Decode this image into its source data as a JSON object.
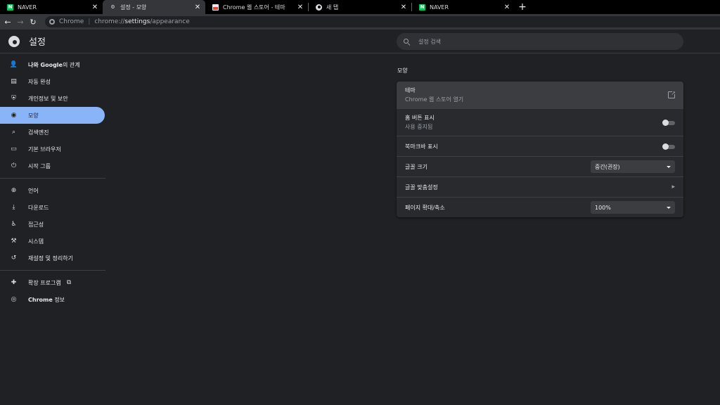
{
  "tabs": [
    {
      "title": "NAVER",
      "favicon": "naver-icon",
      "close": "✕"
    },
    {
      "title": "설정 - 모양",
      "favicon": "gear-icon",
      "close": "✕"
    },
    {
      "title": "Chrome 웹 스토어 - 테마",
      "favicon": "web-store-icon",
      "close": "✕"
    },
    {
      "title": "새 탭",
      "favicon": "chrome-icon",
      "close": "✕"
    },
    {
      "title": "NAVER",
      "favicon": "naver-icon",
      "close": "✕"
    }
  ],
  "new_tab_label": "+",
  "toolbar": {
    "back": "←",
    "forward": "→",
    "reload": "↻",
    "site_label": "Chrome",
    "url_prefix": "chrome://",
    "url_bold": "settings",
    "url_suffix": "/appearance"
  },
  "header": {
    "title": "설정",
    "search_placeholder": "설정 검색"
  },
  "sidebar": {
    "items": [
      {
        "label_bold": "나와 Google",
        "label_rest": "의 관계",
        "icon": "person-icon",
        "glyph": "👤"
      },
      {
        "label": "자동 완성",
        "icon": "clipboard-icon",
        "glyph": "▤"
      },
      {
        "label": "개인정보 및 보안",
        "icon": "shield-icon",
        "glyph": "⛨"
      },
      {
        "label": "모양",
        "icon": "palette-icon",
        "glyph": "◉"
      },
      {
        "label": "검색엔진",
        "icon": "search-icon",
        "glyph": "⌕"
      },
      {
        "label": "기본 브라우저",
        "icon": "browser-icon",
        "glyph": "▭"
      },
      {
        "label": "시작 그룹",
        "icon": "power-icon",
        "glyph": "⏻"
      },
      {
        "label": "언어",
        "icon": "globe-icon",
        "glyph": "⊕"
      },
      {
        "label": "다운로드",
        "icon": "download-icon",
        "glyph": "⤓"
      },
      {
        "label": "접근성",
        "icon": "accessibility-icon",
        "glyph": "♿"
      },
      {
        "label": "시스템",
        "icon": "wrench-icon",
        "glyph": "⚒"
      },
      {
        "label": "재설정 및 정리하기",
        "icon": "history-icon",
        "glyph": "↺"
      },
      {
        "label": "확장 프로그램",
        "icon": "puzzle-icon",
        "glyph": "✚"
      },
      {
        "label_bold": "Chrome",
        "label_rest": " 정보",
        "icon": "chrome-icon",
        "glyph": "◎"
      }
    ],
    "external_link_glyph": "⧉"
  },
  "main": {
    "section_title": "모양",
    "theme": {
      "title": "테마",
      "subtitle": "Chrome 웹 스토어 열기"
    },
    "home_button": {
      "title": "홈 버튼 표시",
      "subtitle": "사용 중지됨",
      "enabled": false
    },
    "bookmarks_bar": {
      "title": "북마크바 표시",
      "enabled": false
    },
    "font_size": {
      "title": "글꼴 크기",
      "value": "중간(권장)"
    },
    "customize_fonts": {
      "title": "글꼴 맞춤설정",
      "chevron": "▸"
    },
    "page_zoom": {
      "title": "페이지 확대/축소",
      "value": "100%"
    }
  }
}
